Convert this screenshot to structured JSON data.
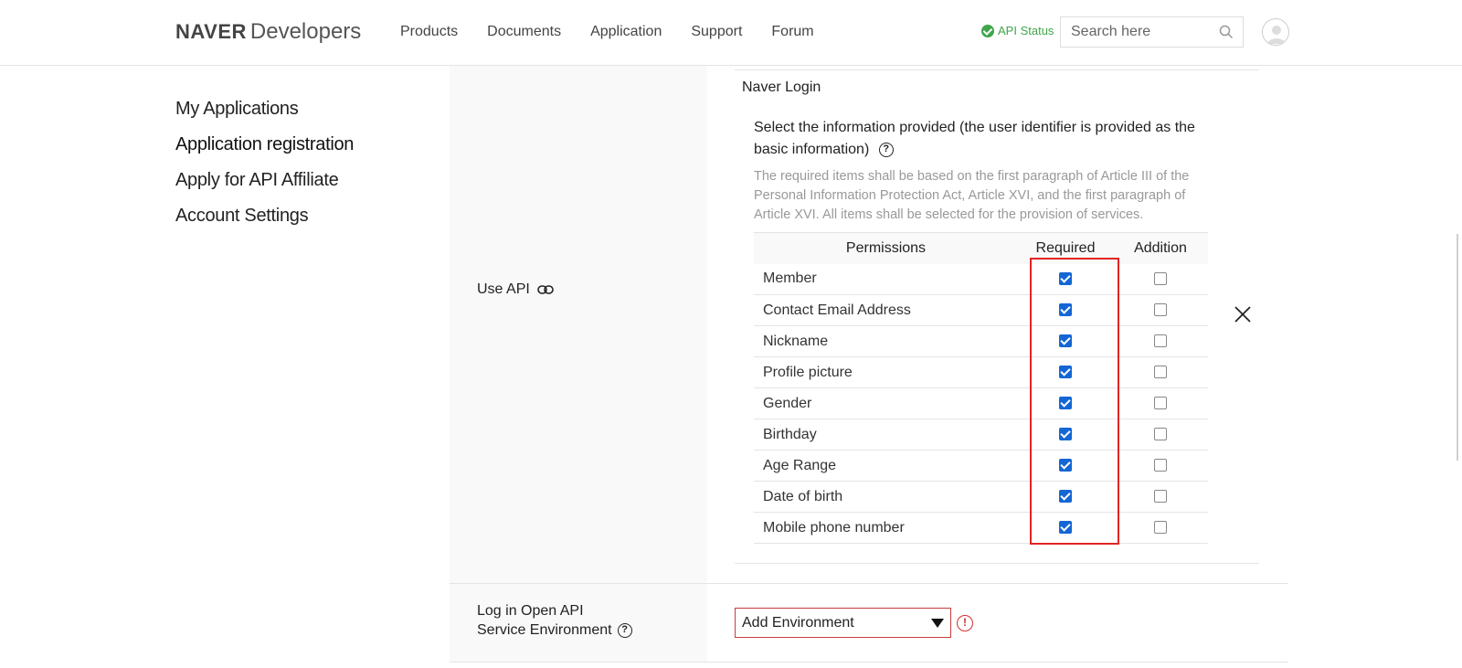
{
  "header": {
    "logo_brand": "NAVER",
    "logo_product": "Developers",
    "nav": [
      "Products",
      "Documents",
      "Application",
      "Support",
      "Forum"
    ],
    "api_status": "API Status",
    "search_placeholder": "Search here"
  },
  "sidebar": {
    "items": [
      {
        "label": "My Applications"
      },
      {
        "label": "Application registration"
      },
      {
        "label": "Apply for API Affiliate"
      },
      {
        "label": "Account Settings"
      }
    ]
  },
  "form": {
    "use_api_label": "Use API",
    "panel_title": "Naver Login",
    "select_info": "Select the information provided (the user identifier is provided as the basic information)",
    "notice": "The required items shall be based on the first paragraph of Article III of the Personal Information Protection Act, Article XVI, and the first paragraph of Article XVI. All items shall be selected for the provision of services.",
    "table_headers": {
      "permissions": "Permissions",
      "required": "Required",
      "addition": "Addition"
    },
    "permissions": [
      {
        "name": "Member",
        "required": true,
        "addition": false
      },
      {
        "name": "Contact Email Address",
        "required": true,
        "addition": false
      },
      {
        "name": "Nickname",
        "required": true,
        "addition": false
      },
      {
        "name": "Profile picture",
        "required": true,
        "addition": false
      },
      {
        "name": "Gender",
        "required": true,
        "addition": false
      },
      {
        "name": "Birthday",
        "required": true,
        "addition": false
      },
      {
        "name": "Age Range",
        "required": true,
        "addition": false
      },
      {
        "name": "Date of birth",
        "required": true,
        "addition": false
      },
      {
        "name": "Mobile phone number",
        "required": true,
        "addition": false
      }
    ],
    "env_label_line1": "Log in Open API",
    "env_label_line2": "Service Environment",
    "env_select_value": "Add Environment",
    "warn_symbol": "!"
  },
  "colors": {
    "accent": "#1466d4",
    "status_green": "#3fa64a",
    "highlight_red": "#e02424"
  }
}
